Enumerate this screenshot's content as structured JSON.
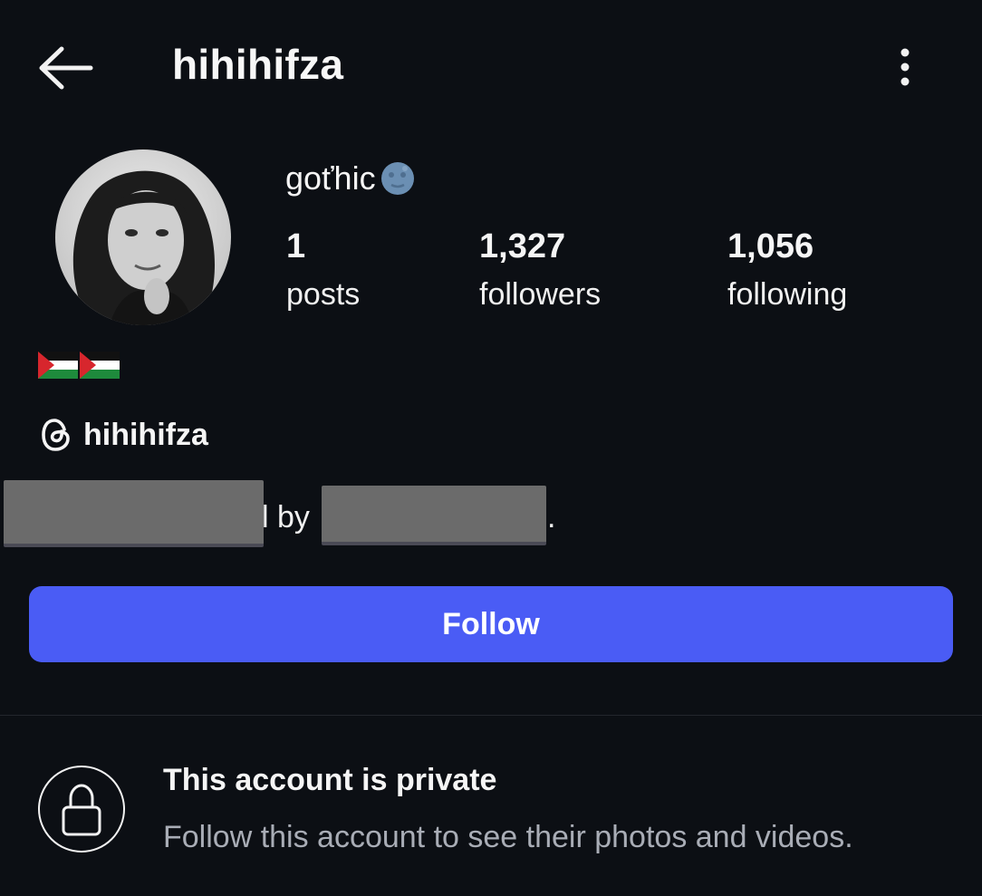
{
  "header": {
    "title": "hihihifza",
    "back_icon": "arrow-left-icon",
    "more_icon": "vertical-dots-icon"
  },
  "profile": {
    "display_name": "goťhic",
    "name_emoji": "new-moon-face-icon",
    "stats": [
      {
        "count": "1",
        "label": "posts"
      },
      {
        "count": "1,327",
        "label": "followers"
      },
      {
        "count": "1,056",
        "label": "following"
      }
    ],
    "bio_emoji": [
      "palestine-flag-icon",
      "palestine-flag-icon"
    ],
    "threads_handle": "hihihifza",
    "mutual_text": "l by",
    "mutual_suffix": "."
  },
  "actions": {
    "follow_label": "Follow",
    "follow_color": "#4a5cf5"
  },
  "private_notice": {
    "title": "This account is private",
    "subtitle": "Follow this account to see their photos and videos.",
    "icon": "lock-icon"
  }
}
